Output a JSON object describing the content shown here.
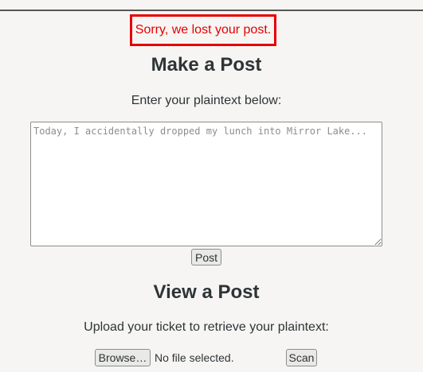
{
  "error_message": "Sorry, we lost your post.",
  "make_post": {
    "title": "Make a Post",
    "instruction": "Enter your plaintext below:",
    "textarea_placeholder": "Today, I accidentally dropped my lunch into Mirror Lake...",
    "textarea_value": "",
    "submit_label": "Post"
  },
  "view_post": {
    "title": "View a Post",
    "instruction": "Upload your ticket to retrieve your plaintext:",
    "browse_label": "Browse…",
    "file_status": "No file selected.",
    "scan_label": "Scan"
  },
  "colors": {
    "error": "#e60000",
    "background": "#f6f5f4",
    "text": "#2e3436"
  }
}
